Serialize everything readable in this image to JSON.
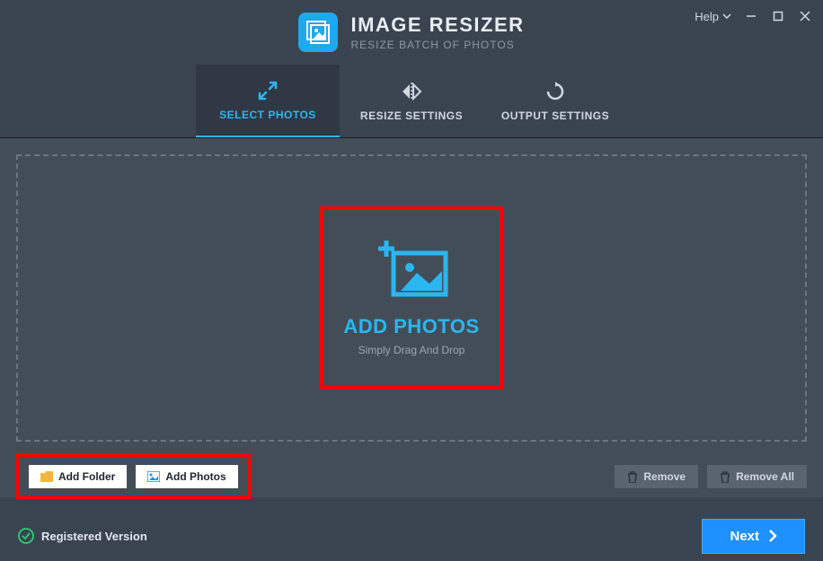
{
  "header": {
    "title": "IMAGE RESIZER",
    "subtitle": "RESIZE BATCH OF PHOTOS",
    "help_label": "Help"
  },
  "tabs": {
    "select": "SELECT PHOTOS",
    "resize": "RESIZE SETTINGS",
    "output": "OUTPUT SETTINGS"
  },
  "dropzone": {
    "add_title": "ADD PHOTOS",
    "add_subtitle": "Simply Drag And Drop"
  },
  "toolbar": {
    "add_folder": "Add Folder",
    "add_photos": "Add Photos",
    "remove": "Remove",
    "remove_all": "Remove All"
  },
  "footer": {
    "status": "Registered Version",
    "next": "Next"
  }
}
